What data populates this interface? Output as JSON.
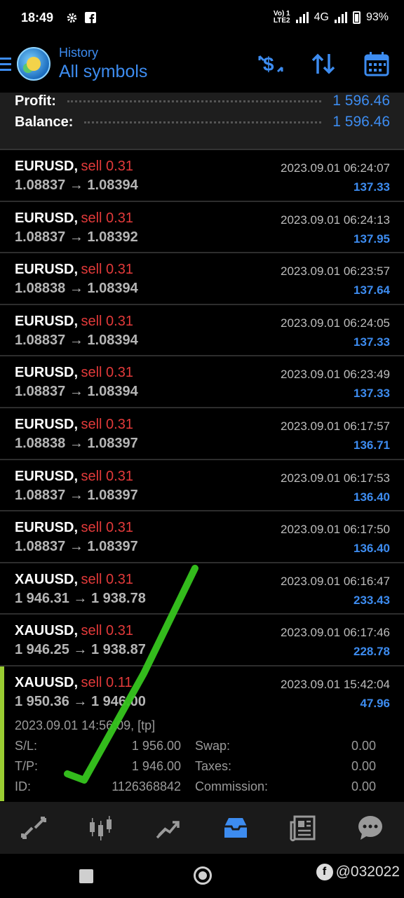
{
  "status_bar": {
    "time": "18:49",
    "network_top": "Vo) 1",
    "network_bottom": "LTE2",
    "network_type": "4G",
    "battery": "93%"
  },
  "header": {
    "subtitle": "History",
    "title": "All symbols",
    "accent_color": "#3d8cf0",
    "actions": [
      "dollar-sort-icon",
      "sort-arrows-icon",
      "calendar-icon"
    ]
  },
  "summary": {
    "profit_label": "Profit:",
    "profit_value": "1 596.46",
    "balance_label": "Balance:",
    "balance_value": "1 596.46"
  },
  "trades": [
    {
      "symbol": "EURUSD,",
      "side": "sell 0.31",
      "open": "1.08837",
      "arrow": "→",
      "close": "1.08394",
      "date": "2023.09.01 06:24:07",
      "profit": "137.33"
    },
    {
      "symbol": "EURUSD,",
      "side": "sell 0.31",
      "open": "1.08837",
      "arrow": "→",
      "close": "1.08392",
      "date": "2023.09.01 06:24:13",
      "profit": "137.95"
    },
    {
      "symbol": "EURUSD,",
      "side": "sell 0.31",
      "open": "1.08838",
      "arrow": "→",
      "close": "1.08394",
      "date": "2023.09.01 06:23:57",
      "profit": "137.64"
    },
    {
      "symbol": "EURUSD,",
      "side": "sell 0.31",
      "open": "1.08837",
      "arrow": "→",
      "close": "1.08394",
      "date": "2023.09.01 06:24:05",
      "profit": "137.33"
    },
    {
      "symbol": "EURUSD,",
      "side": "sell 0.31",
      "open": "1.08837",
      "arrow": "→",
      "close": "1.08394",
      "date": "2023.09.01 06:23:49",
      "profit": "137.33"
    },
    {
      "symbol": "EURUSD,",
      "side": "sell 0.31",
      "open": "1.08838",
      "arrow": "→",
      "close": "1.08397",
      "date": "2023.09.01 06:17:57",
      "profit": "136.71"
    },
    {
      "symbol": "EURUSD,",
      "side": "sell 0.31",
      "open": "1.08837",
      "arrow": "→",
      "close": "1.08397",
      "date": "2023.09.01 06:17:53",
      "profit": "136.40"
    },
    {
      "symbol": "EURUSD,",
      "side": "sell 0.31",
      "open": "1.08837",
      "arrow": "→",
      "close": "1.08397",
      "date": "2023.09.01 06:17:50",
      "profit": "136.40"
    },
    {
      "symbol": "XAUUSD,",
      "side": "sell 0.31",
      "open": "1 946.31",
      "arrow": "→",
      "close": "1 938.78",
      "date": "2023.09.01 06:16:47",
      "profit": "233.43"
    },
    {
      "symbol": "XAUUSD,",
      "side": "sell 0.31",
      "open": "1 946.25",
      "arrow": "→",
      "close": "1 938.87",
      "date": "2023.09.01 06:17:46",
      "profit": "228.78"
    }
  ],
  "expanded_trade": {
    "symbol": "XAUUSD,",
    "side": "sell 0.11",
    "open": "1 950.36",
    "arrow": "→",
    "close": "1 946.00",
    "date": "2023.09.01 15:42:04",
    "profit": "47.96",
    "open_time": "2023.09.01 14:56:09, [tp]",
    "sl_label": "S/L:",
    "sl_value": "1 956.00",
    "swap_label": "Swap:",
    "swap_value": "0.00",
    "tp_label": "T/P:",
    "tp_value": "1 946.00",
    "taxes_label": "Taxes:",
    "taxes_value": "0.00",
    "id_label": "ID:",
    "id_value": "1126368842",
    "commission_label": "Commission:",
    "commission_value": "0.00"
  },
  "bottom_nav": {
    "items": [
      "quotes-icon",
      "chart-icon",
      "trade-icon",
      "history-icon",
      "news-icon",
      "chat-icon"
    ],
    "active": "history-icon"
  },
  "watermark": {
    "handle": "@032022"
  }
}
